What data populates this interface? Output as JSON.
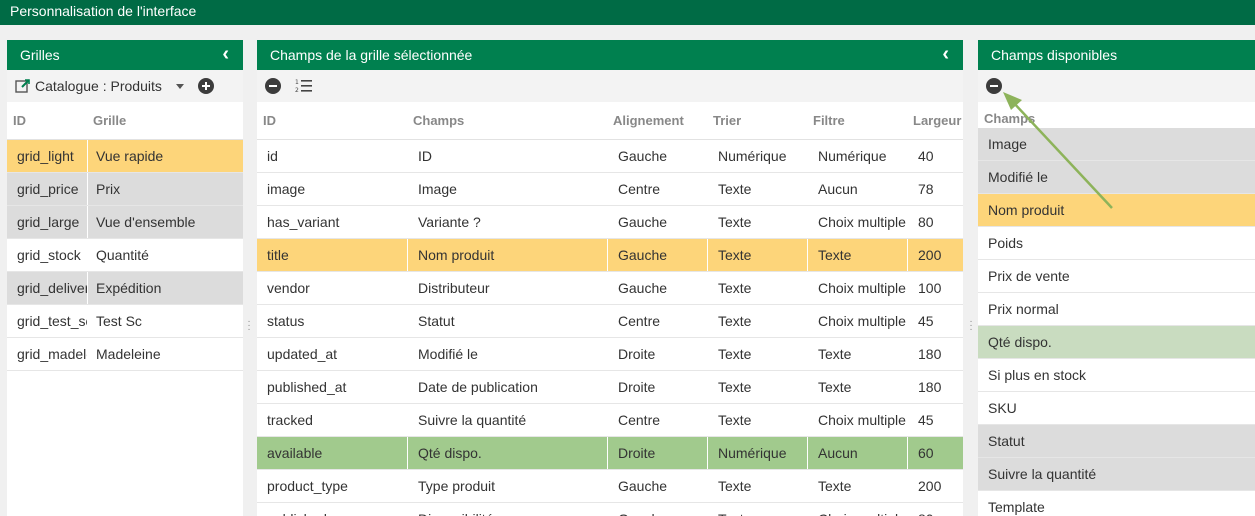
{
  "app": {
    "title": "Personnalisation de l'interface"
  },
  "grilles": {
    "title": "Grilles",
    "selector_label": "Catalogue : Produits",
    "headers": {
      "id": "ID",
      "grille": "Grille"
    },
    "rows": [
      {
        "id": "grid_light",
        "name": "Vue rapide",
        "hl": "yellow"
      },
      {
        "id": "grid_price",
        "name": "Prix",
        "hl": "gray"
      },
      {
        "id": "grid_large",
        "name": "Vue d'ensemble",
        "hl": "gray"
      },
      {
        "id": "grid_stock",
        "name": "Quantité",
        "hl": ""
      },
      {
        "id": "grid_delivery",
        "name": "Expédition",
        "hl": "gray"
      },
      {
        "id": "grid_test_sc",
        "name": "Test Sc",
        "hl": ""
      },
      {
        "id": "grid_madeleine",
        "name": "Madeleine",
        "hl": ""
      }
    ]
  },
  "champs": {
    "title": "Champs de la grille sélectionnée",
    "headers": {
      "id": "ID",
      "champs": "Champs",
      "alignement": "Alignement",
      "trier": "Trier",
      "filtre": "Filtre",
      "largeur": "Largeur"
    },
    "rows": [
      {
        "id": "id",
        "champs": "ID",
        "alignement": "Gauche",
        "trier": "Numérique",
        "filtre": "Numérique",
        "largeur": "40",
        "hl": ""
      },
      {
        "id": "image",
        "champs": "Image",
        "alignement": "Centre",
        "trier": "Texte",
        "filtre": "Aucun",
        "largeur": "78",
        "hl": ""
      },
      {
        "id": "has_variant",
        "champs": "Variante ?",
        "alignement": "Gauche",
        "trier": "Texte",
        "filtre": "Choix multiple",
        "largeur": "80",
        "hl": ""
      },
      {
        "id": "title",
        "champs": "Nom produit",
        "alignement": "Gauche",
        "trier": "Texte",
        "filtre": "Texte",
        "largeur": "200",
        "hl": "yellow"
      },
      {
        "id": "vendor",
        "champs": "Distributeur",
        "alignement": "Gauche",
        "trier": "Texte",
        "filtre": "Choix multiple",
        "largeur": "100",
        "hl": ""
      },
      {
        "id": "status",
        "champs": "Statut",
        "alignement": "Centre",
        "trier": "Texte",
        "filtre": "Choix multiple",
        "largeur": "45",
        "hl": ""
      },
      {
        "id": "updated_at",
        "champs": "Modifié le",
        "alignement": "Droite",
        "trier": "Texte",
        "filtre": "Texte",
        "largeur": "180",
        "hl": ""
      },
      {
        "id": "published_at",
        "champs": "Date de publication",
        "alignement": "Droite",
        "trier": "Texte",
        "filtre": "Texte",
        "largeur": "180",
        "hl": ""
      },
      {
        "id": "tracked",
        "champs": "Suivre la quantité",
        "alignement": "Centre",
        "trier": "Texte",
        "filtre": "Choix multiple",
        "largeur": "45",
        "hl": ""
      },
      {
        "id": "available",
        "champs": "Qté dispo.",
        "alignement": "Droite",
        "trier": "Numérique",
        "filtre": "Aucun",
        "largeur": "60",
        "hl": "green"
      },
      {
        "id": "product_type",
        "champs": "Type produit",
        "alignement": "Gauche",
        "trier": "Texte",
        "filtre": "Texte",
        "largeur": "200",
        "hl": ""
      },
      {
        "id": "published",
        "champs": "Disponibilité",
        "alignement": "Gauche",
        "trier": "Texte",
        "filtre": "Choix multiple",
        "largeur": "80",
        "hl": ""
      }
    ]
  },
  "disponibles": {
    "title": "Champs disponibles",
    "header": "Champs",
    "rows": [
      {
        "label": "Image",
        "hl": "gray"
      },
      {
        "label": "Modifié le",
        "hl": "gray"
      },
      {
        "label": "Nom produit",
        "hl": "yellow"
      },
      {
        "label": "Poids",
        "hl": ""
      },
      {
        "label": "Prix de vente",
        "hl": ""
      },
      {
        "label": "Prix normal",
        "hl": ""
      },
      {
        "label": "Qté dispo.",
        "hl": "lightgreen"
      },
      {
        "label": "Si plus en stock",
        "hl": ""
      },
      {
        "label": "SKU",
        "hl": ""
      },
      {
        "label": "Statut",
        "hl": "gray"
      },
      {
        "label": "Suivre la quantité",
        "hl": "gray"
      },
      {
        "label": "Template",
        "hl": ""
      }
    ]
  },
  "icons": {
    "collapse": "chevron-left-icon",
    "edit": "edit-external-icon",
    "dropdown": "caret-down-icon",
    "add": "plus-circle-icon",
    "remove": "minus-circle-icon",
    "list": "ordered-list-icon",
    "annotation": "arrow-annotation"
  },
  "colors": {
    "topbar": "#006b45",
    "panel_header": "#00804f",
    "selected_yellow": "#fdd57a",
    "gray": "#dcdcdc",
    "green": "#a1ca8d",
    "light_green": "#c9dcc0",
    "arrow": "#8db35a"
  }
}
